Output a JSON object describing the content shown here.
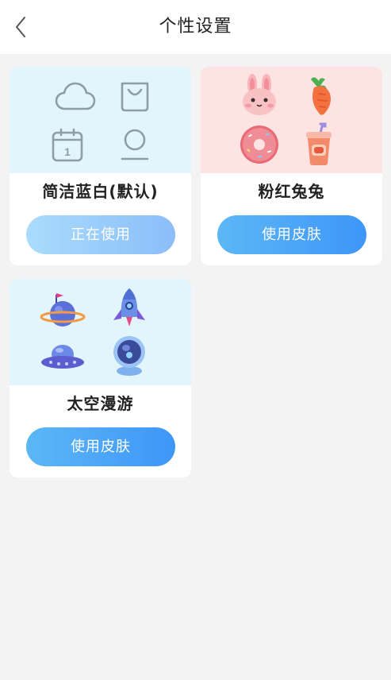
{
  "header": {
    "title": "个性设置",
    "back_icon": "chevron-left-icon"
  },
  "skins": [
    {
      "name": "简洁蓝白(默认)",
      "button_label": "正在使用",
      "state": "current",
      "preview_color": "#e2f4fc",
      "icons": [
        "cloud-icon",
        "bag-icon",
        "calendar-icon",
        "user-icon"
      ]
    },
    {
      "name": "粉红兔兔",
      "button_label": "使用皮肤",
      "state": "available",
      "preview_color": "#fde3e1",
      "icons": [
        "bunny-icon",
        "carrot-icon",
        "donut-icon",
        "drink-cup-icon"
      ]
    },
    {
      "name": "太空漫游",
      "button_label": "使用皮肤",
      "state": "available",
      "preview_color": "#e2f4fc",
      "icons": [
        "planet-icon",
        "rocket-icon",
        "ufo-icon",
        "astronaut-icon"
      ]
    }
  ],
  "calendar_icon_text": "1",
  "colors": {
    "accent": "#3e96f8",
    "current_button": "#a9dcfc",
    "background": "#f3f3f3"
  }
}
